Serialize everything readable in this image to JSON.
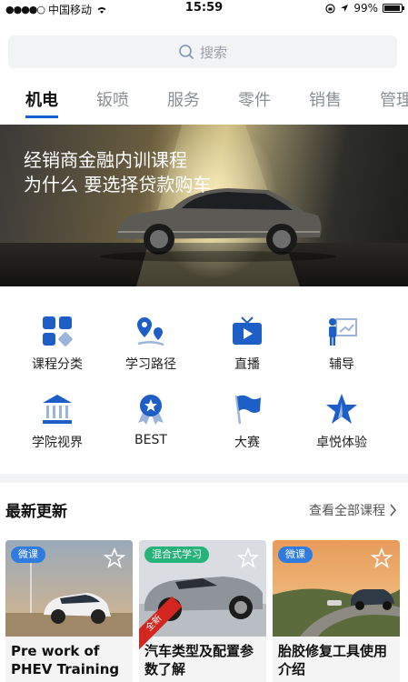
{
  "status_bar": {
    "carrier": "中国移动",
    "time": "15:59",
    "battery": "99%"
  },
  "search": {
    "placeholder": "搜索"
  },
  "tabs": [
    {
      "label": "机电",
      "active": true
    },
    {
      "label": "钣喷"
    },
    {
      "label": "服务"
    },
    {
      "label": "零件"
    },
    {
      "label": "销售"
    },
    {
      "label": "管理"
    }
  ],
  "banner": {
    "line1": "经销商金融内训课程",
    "line2": "为什么 要选择贷款购车"
  },
  "grid": [
    {
      "label": "课程分类",
      "icon": "category-icon"
    },
    {
      "label": "学习路径",
      "icon": "path-icon"
    },
    {
      "label": "直播",
      "icon": "live-tv-icon"
    },
    {
      "label": "辅导",
      "icon": "coaching-icon"
    },
    {
      "label": "学院视界",
      "icon": "academy-icon"
    },
    {
      "label": "BEST",
      "icon": "best-medal-icon"
    },
    {
      "label": "大赛",
      "icon": "flag-icon"
    },
    {
      "label": "卓悦体验",
      "icon": "star-icon"
    }
  ],
  "latest": {
    "title": "最新更新",
    "view_all": "查看全部课程"
  },
  "cards": [
    {
      "tag": "微课",
      "tag_color": "#2f7be0",
      "title": "Pre work of PHEV Training"
    },
    {
      "tag": "混合式学习",
      "tag_color": "#26b37a",
      "title": "汽车类型及配置参数了解",
      "ribbon": "全新"
    },
    {
      "tag": "微课",
      "tag_color": "#2f7be0",
      "title": "胎胶修复工具使用介绍"
    }
  ],
  "colors": {
    "accent": "#1a5fd0",
    "icon_blue": "#1d5fc7"
  }
}
